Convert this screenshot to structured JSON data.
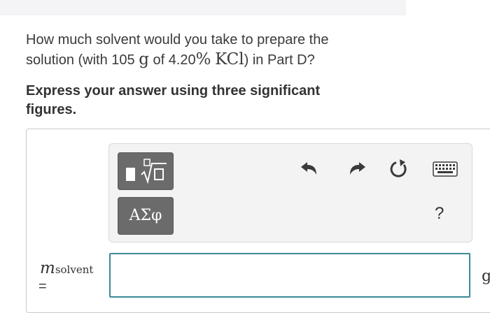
{
  "question": {
    "line1": "How much solvent would you take to prepare the",
    "line2_prefix": "solution (with 105 ",
    "line2_g": "g",
    "line2_mid": " of 4.20",
    "line2_pct": "%",
    "line2_sp": " ",
    "line2_kcl": "KCl",
    "line2_suffix": ") in Part D?"
  },
  "instruction": {
    "line1": "Express your answer using three significant",
    "line2": "figures."
  },
  "toolbar": {
    "symbols_label": "ΑΣφ",
    "help_label": "?"
  },
  "answer": {
    "variable_main": "m",
    "variable_sub": "solvent",
    "equals": "=",
    "value": "",
    "unit": "g"
  },
  "colors": {
    "input_border": "#3c8a96",
    "tool_button": "#6b6b6b",
    "toolbar_bg": "#f3f3f3"
  },
  "icons": [
    "templates-icon",
    "undo-icon",
    "redo-icon",
    "reset-icon",
    "keyboard-icon"
  ]
}
